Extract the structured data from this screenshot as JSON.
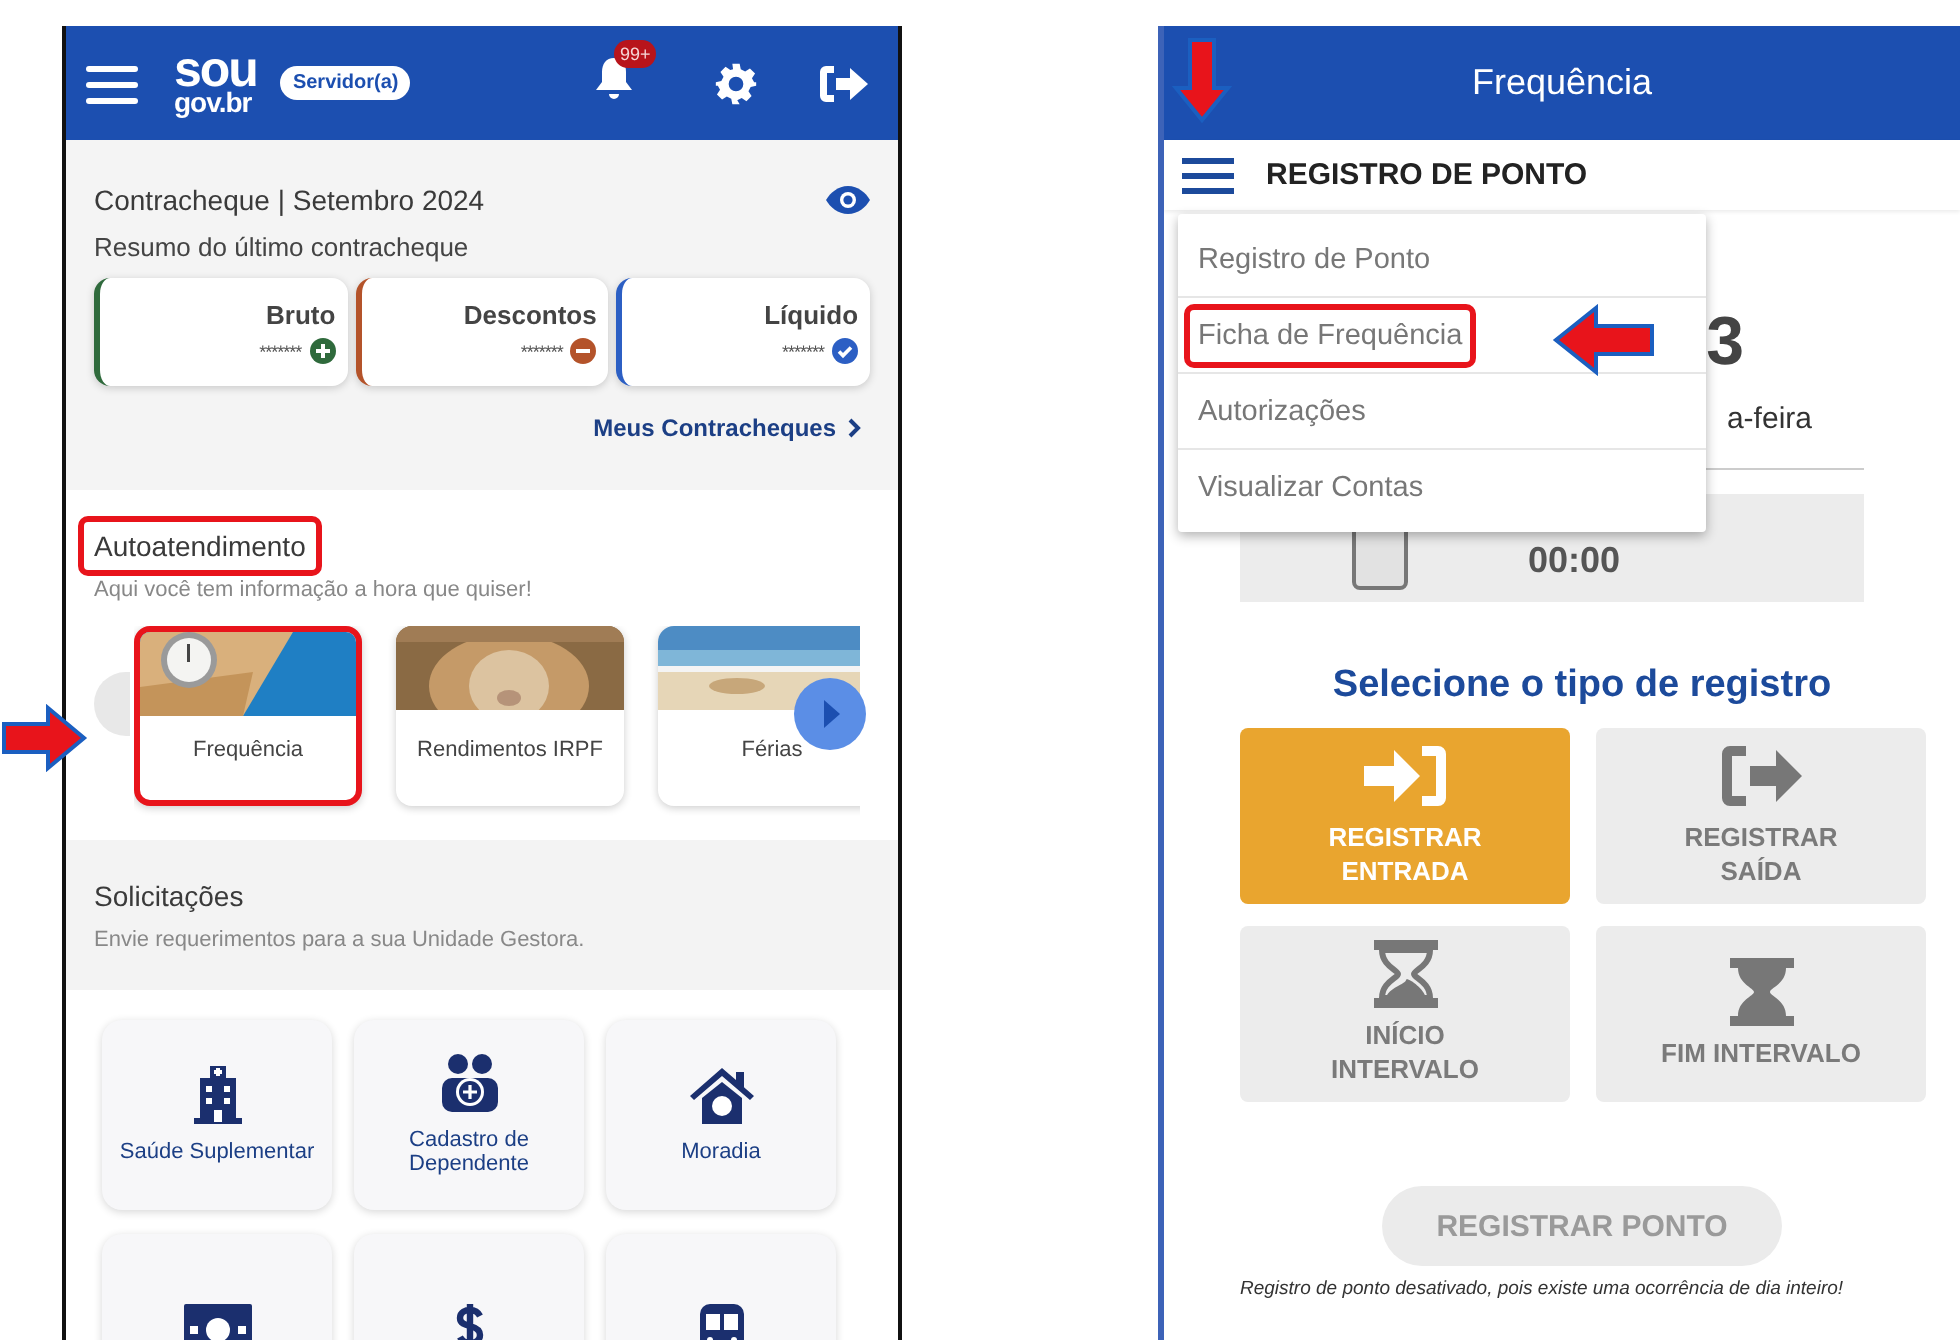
{
  "left_screen": {
    "header": {
      "logo_top": "sou",
      "logo_bottom": "gov.br",
      "role_badge": "Servidor(a)",
      "notification_count": "99+"
    },
    "payslip": {
      "title": "Contracheque | Setembro 2024",
      "subtitle": "Resumo do último contracheque",
      "link": "Meus Contracheques",
      "cards": [
        {
          "label": "Bruto",
          "value": "*******",
          "kind": "plus",
          "color": "#2f6a3c"
        },
        {
          "label": "Descontos",
          "value": "*******",
          "kind": "minus",
          "color": "#b4532a"
        },
        {
          "label": "Líquido",
          "value": "*******",
          "kind": "check",
          "color": "#2c5fc4"
        }
      ]
    },
    "self_service": {
      "title": "Autoatendimento",
      "title_highlighted": true,
      "subtitle": "Aqui você tem informação a hora que quiser!",
      "cards": [
        {
          "label": "Frequência",
          "kind": "clock",
          "highlighted": true
        },
        {
          "label": "Rendimentos IRPF",
          "kind": "animal",
          "highlighted": false
        },
        {
          "label": "Férias",
          "kind": "beach",
          "highlighted": false
        }
      ]
    },
    "requests": {
      "title": "Solicitações",
      "subtitle": "Envie requerimentos para a sua Unidade Gestora.",
      "tiles": [
        {
          "label": "Saúde Suplementar",
          "kind": "hospital"
        },
        {
          "label": "Cadastro de Dependente",
          "kind": "people"
        },
        {
          "label": "Moradia",
          "kind": "house"
        },
        {
          "kind": "money"
        },
        {
          "kind": "dollar"
        },
        {
          "kind": "bus"
        }
      ]
    }
  },
  "right_screen": {
    "title": "Frequência",
    "menu_button": {
      "highlighted": true
    },
    "toolbar_title": "REGISTRO DE PONTO",
    "menu": {
      "items": [
        {
          "label": "Registro de Ponto",
          "highlighted": false
        },
        {
          "label": "Ficha de Frequência",
          "highlighted": true
        },
        {
          "label": "Autorizações",
          "highlighted": false
        },
        {
          "label": "Visualizar Contas",
          "highlighted": false
        }
      ]
    },
    "date": {
      "day": "3",
      "weekday": "a-feira"
    },
    "hours": {
      "value": "00:00"
    },
    "register": {
      "title": "Selecione o tipo de registro",
      "options": [
        {
          "label": "REGISTRAR ENTRADA",
          "kind": "enter",
          "selected": true
        },
        {
          "label": "REGISTRAR SAÍDA",
          "kind": "exit",
          "selected": false
        },
        {
          "label": "INÍCIO INTERVALO",
          "kind": "hourglass_start",
          "selected": false
        },
        {
          "label": "FIM INTERVALO",
          "kind": "hourglass_end",
          "selected": false
        }
      ]
    },
    "submit": {
      "label": "REGISTRAR PONTO",
      "disabled": true
    },
    "note": "Registro de ponto desativado, pois existe uma ocorrência de dia inteiro!"
  }
}
